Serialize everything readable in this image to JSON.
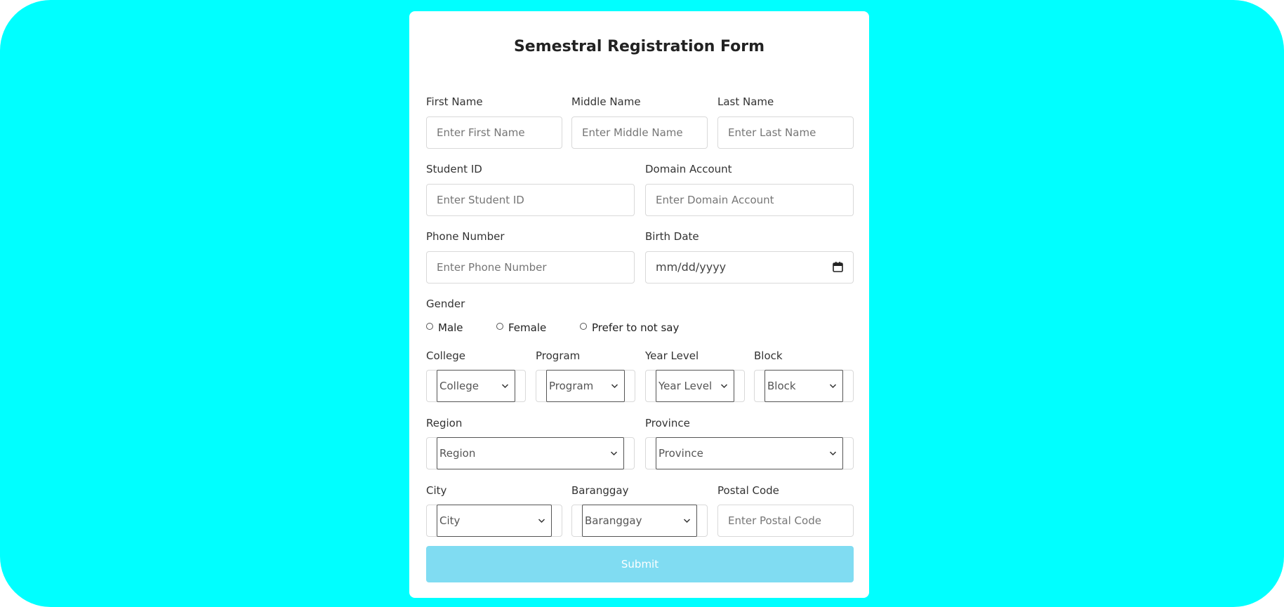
{
  "colors": {
    "page_background": "#00ffff",
    "card_background": "#ffffff",
    "submit_button": "#80dcf2"
  },
  "form": {
    "title": "Semestral Registration Form",
    "first_name": {
      "label": "First Name",
      "placeholder": "Enter First Name"
    },
    "middle_name": {
      "label": "Middle Name",
      "placeholder": "Enter Middle Name"
    },
    "last_name": {
      "label": "Last Name",
      "placeholder": "Enter Last Name"
    },
    "student_id": {
      "label": "Student ID",
      "placeholder": "Enter Student ID"
    },
    "domain_account": {
      "label": "Domain Account",
      "placeholder": "Enter Domain Account"
    },
    "phone_number": {
      "label": "Phone Number",
      "placeholder": "Enter Phone Number"
    },
    "birth_date": {
      "label": "Birth Date",
      "value": "mm/dd/yyyy",
      "icon": "calendar-icon"
    },
    "gender": {
      "label": "Gender",
      "options": [
        "Male",
        "Female",
        "Prefer to not say"
      ]
    },
    "college": {
      "label": "College",
      "selected": "College"
    },
    "program": {
      "label": "Program",
      "selected": "Program"
    },
    "year_level": {
      "label": "Year Level",
      "selected": "Year Level"
    },
    "block": {
      "label": "Block",
      "selected": "Block"
    },
    "region": {
      "label": "Region",
      "selected": "Region"
    },
    "province": {
      "label": "Province",
      "selected": "Province"
    },
    "city": {
      "label": "City",
      "selected": "City"
    },
    "barangay": {
      "label": "Baranggay",
      "selected": "Baranggay"
    },
    "postal_code": {
      "label": "Postal Code",
      "placeholder": "Enter Postal Code"
    },
    "submit_label": "Submit"
  }
}
